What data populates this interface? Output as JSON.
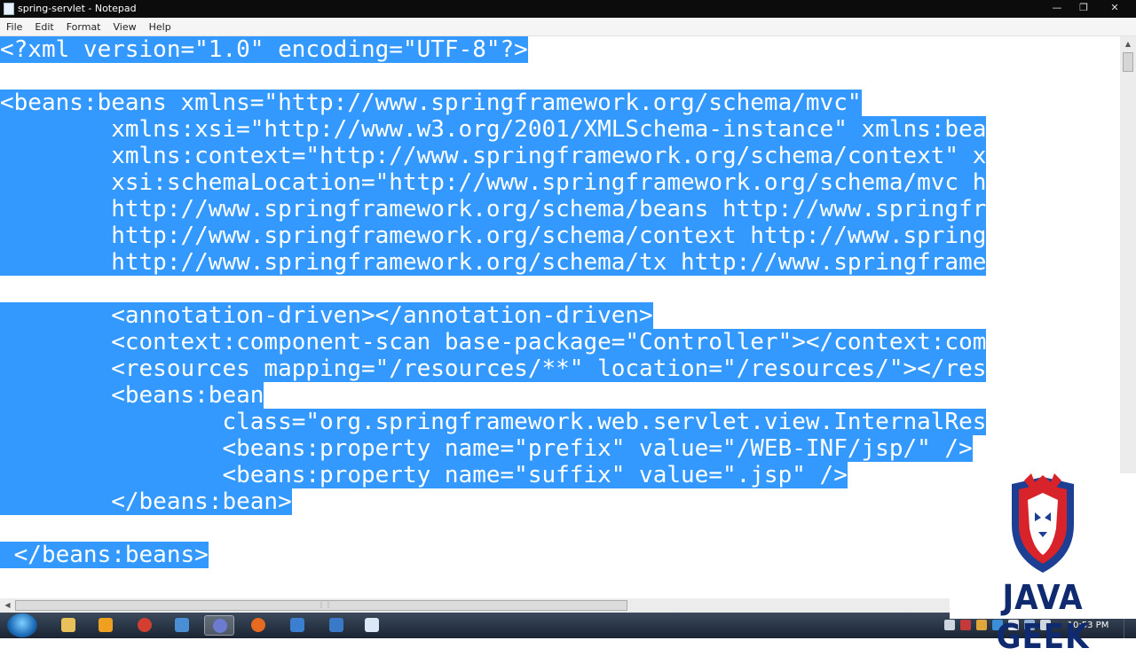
{
  "window": {
    "title": "spring-servlet - Notepad"
  },
  "menu": [
    "File",
    "Edit",
    "Format",
    "View",
    "Help"
  ],
  "editor_lines": [
    "<?xml version=\"1.0\" encoding=\"UTF-8\"?>",
    "",
    "<beans:beans xmlns=\"http://www.springframework.org/schema/mvc\"",
    "        xmlns:xsi=\"http://www.w3.org/2001/XMLSchema-instance\" xmlns:bea",
    "        xmlns:context=\"http://www.springframework.org/schema/context\" x",
    "        xsi:schemaLocation=\"http://www.springframework.org/schema/mvc h",
    "        http://www.springframework.org/schema/beans http://www.springfr",
    "        http://www.springframework.org/schema/context http://www.spring",
    "        http://www.springframework.org/schema/tx http://www.springframe",
    "",
    "        <annotation-driven></annotation-driven>",
    "        <context:component-scan base-package=\"Controller\"></context:com",
    "        <resources mapping=\"/resources/**\" location=\"/resources/\"></res",
    "        <beans:bean",
    "                class=\"org.springframework.web.servlet.view.InternalRes",
    "                <beans:property name=\"prefix\" value=\"/WEB-INF/jsp/\" />",
    "                <beans:property name=\"suffix\" value=\".jsp\" />",
    "        </beans:bean>",
    "",
    " </beans:beans>"
  ],
  "taskbar": {
    "clock": "10:53 PM"
  },
  "watermark": {
    "text": "JAVA GEEK"
  },
  "colors": {
    "selection": "#3399ff",
    "titlebar": "#0c0c0c",
    "taskbar": "#23303f"
  }
}
